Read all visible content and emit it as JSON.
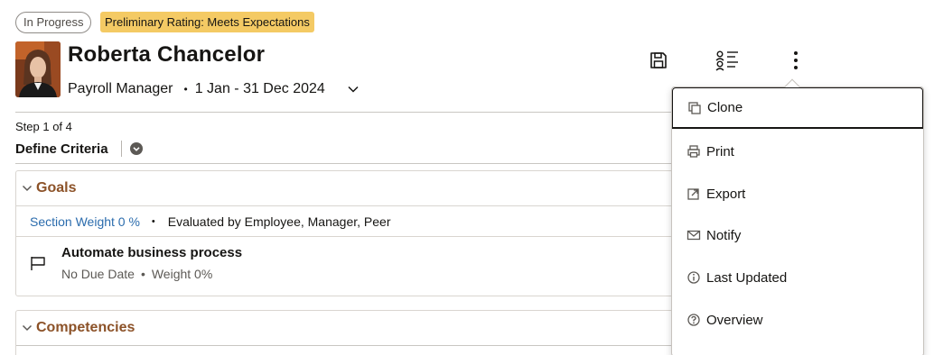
{
  "badges": {
    "status": "In Progress",
    "rating": "Preliminary Rating: Meets Expectations"
  },
  "employee": {
    "name": "Roberta Chancelor",
    "role": "Payroll Manager",
    "separator": "•",
    "period": "1 Jan - 31 Dec 2024"
  },
  "header_icons": [
    "save-icon",
    "participants-list-icon",
    "more-actions-icon"
  ],
  "step": {
    "label": "Step 1 of 4",
    "title": "Define Criteria"
  },
  "goals": {
    "title": "Goals",
    "section_weight": "Section Weight 0 %",
    "bullet": "•",
    "evaluated_by": "Evaluated by Employee, Manager, Peer",
    "item": {
      "title": "Automate business process",
      "due": "No Due Date",
      "dot": "•",
      "weight": "Weight 0%"
    }
  },
  "competencies": {
    "title": "Competencies"
  },
  "menu": {
    "items": [
      {
        "label": "Clone",
        "icon": "clone-icon"
      },
      {
        "label": "Print",
        "icon": "print-icon"
      },
      {
        "label": "Export",
        "icon": "export-icon"
      },
      {
        "label": "Notify",
        "icon": "mail-icon"
      },
      {
        "label": "Last Updated",
        "icon": "info-icon"
      },
      {
        "label": "Overview",
        "icon": "help-icon"
      }
    ]
  },
  "colors": {
    "rating_badge": "#f4ca64",
    "section_title": "#8c5228",
    "link": "#2b6cad"
  }
}
